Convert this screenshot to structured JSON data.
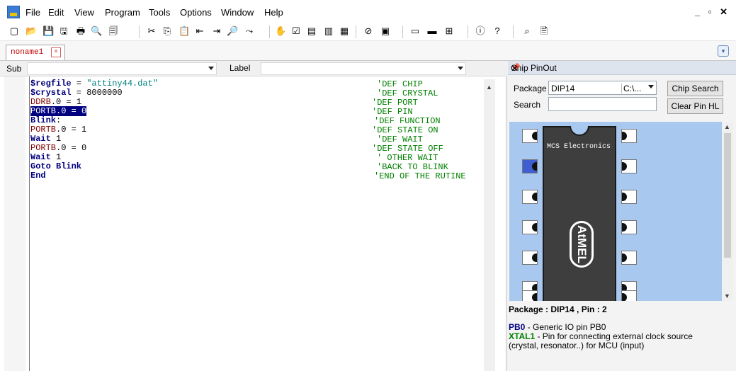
{
  "menu": [
    "File",
    "Edit",
    "View",
    "Program",
    "Tools",
    "Options",
    "Window",
    "Help"
  ],
  "window_controls": "_ ▫ ✕",
  "toolbar_icons": [
    "new-file-icon",
    "open-folder-icon",
    "save-icon",
    "save-all-icon",
    "print-icon",
    "print-preview-icon",
    "copy-disk-icon",
    "cut-icon",
    "copy-icon",
    "paste-icon",
    "indent-icon",
    "outdent-icon",
    "find-icon",
    "find-next-icon",
    "hand-icon",
    "check-syntax-icon",
    "compile-icon",
    "chip-icon",
    "program-chip-icon",
    "stop-icon",
    "simulate-icon",
    "terminal-icon",
    "lcd-designer-icon",
    "graphics-icon",
    "info-icon",
    "help-icon",
    "pinout-icon",
    "pdf-icon"
  ],
  "tab": {
    "label": "noname1"
  },
  "subbar": {
    "sub_label": "Sub",
    "label_label": "Label"
  },
  "code": {
    "lines": [
      {
        "parts": [
          [
            "kw",
            "$regfile"
          ],
          [
            "n",
            " = "
          ],
          [
            "str",
            "\"attiny44.dat\""
          ]
        ],
        "comment": "'DEF CHIP",
        "cpos": 532
      },
      {
        "parts": [
          [
            "kw",
            "$crystal"
          ],
          [
            "n",
            " = 8000000"
          ]
        ],
        "comment": "'DEF CRYSTAL",
        "cpos": 532
      },
      {
        "parts": [
          [
            "reg",
            "DDRB"
          ],
          [
            "n",
            ".0 = 1"
          ]
        ],
        "comment": "'DEF PORT",
        "cpos": 525
      },
      {
        "parts": [
          [
            "sel",
            "PORTB.0 = 0"
          ]
        ],
        "comment": "'DEF PIN",
        "cpos": 525
      },
      {
        "parts": [
          [
            "kw",
            "Blink"
          ],
          [
            "n",
            ":"
          ]
        ],
        "comment": "'DEF FUNCTION",
        "cpos": 528
      },
      {
        "parts": [
          [
            "reg",
            "PORTB"
          ],
          [
            "n",
            ".0 = 1"
          ]
        ],
        "comment": "'DEF STATE ON",
        "cpos": 525
      },
      {
        "parts": [
          [
            "kw",
            "Wait"
          ],
          [
            "n",
            " 1"
          ]
        ],
        "comment": "'DEF WAIT",
        "cpos": 532
      },
      {
        "parts": [
          [
            "reg",
            "PORTB"
          ],
          [
            "n",
            ".0 = 0"
          ]
        ],
        "comment": "'DEF STATE OFF",
        "cpos": 525
      },
      {
        "parts": [
          [
            "kw",
            "Wait"
          ],
          [
            "n",
            " 1"
          ]
        ],
        "comment": "' OTHER WAIT",
        "cpos": 532
      },
      {
        "parts": [
          [
            "kw",
            "Goto Blink"
          ]
        ],
        "comment": "'BACK TO BLINK",
        "cpos": 532
      },
      {
        "parts": [
          [
            "kw",
            "End"
          ]
        ],
        "comment": "'END OF THE RUTINE",
        "cpos": 528
      }
    ]
  },
  "panel": {
    "title": "Chip PinOut",
    "pin_icon": "pin-icon",
    "close_icon": "close-icon",
    "package_label": "Package",
    "package_value": "DIP14",
    "package_path": "C:\\...",
    "search_label": "Search",
    "search_value": "",
    "chip_search_btn": "Chip Search",
    "clear_pin_btn": "Clear Pin HL",
    "chip_brand": "MCS Electronics",
    "logo_text": "AtMEL",
    "selected_pin": 2,
    "pin_title": "Package : DIP14 , Pin : 2",
    "pin_info": [
      {
        "name": "PB0",
        "desc": " - Generic IO pin PB0",
        "cls": "pname"
      },
      {
        "name": "XTAL1",
        "desc": " - Pin for connecting external clock source (crystal, resonator..) for MCU (input)",
        "cls": "pname2"
      }
    ]
  },
  "colors": {
    "selection": "#000080",
    "keyword": "#000080",
    "register": "#800000",
    "string": "#008080",
    "comment": "#008000",
    "chip_bg": "#a8c8ef"
  }
}
